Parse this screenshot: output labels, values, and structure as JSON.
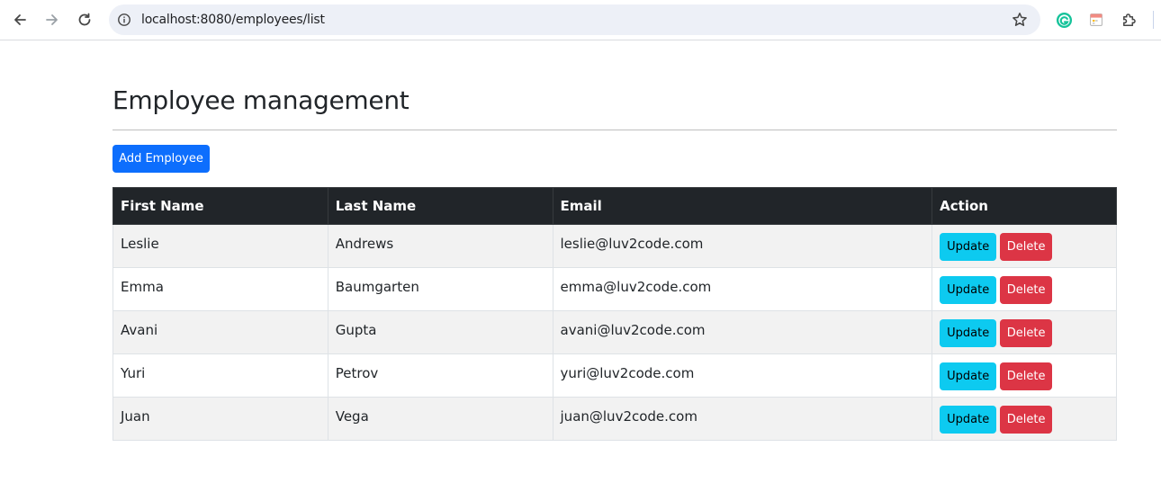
{
  "browser": {
    "url": "localhost:8080/employees/list"
  },
  "page": {
    "title": "Employee management",
    "add_button_label": "Add Employee"
  },
  "table": {
    "headers": {
      "first_name": "First Name",
      "last_name": "Last Name",
      "email": "Email",
      "action": "Action"
    },
    "rows": [
      {
        "first_name": "Leslie",
        "last_name": "Andrews",
        "email": "leslie@luv2code.com",
        "update_label": "Update",
        "delete_label": "Delete"
      },
      {
        "first_name": "Emma",
        "last_name": "Baumgarten",
        "email": "emma@luv2code.com",
        "update_label": "Update",
        "delete_label": "Delete"
      },
      {
        "first_name": "Avani",
        "last_name": "Gupta",
        "email": "avani@luv2code.com",
        "update_label": "Update",
        "delete_label": "Delete"
      },
      {
        "first_name": "Yuri",
        "last_name": "Petrov",
        "email": "yuri@luv2code.com",
        "update_label": "Update",
        "delete_label": "Delete"
      },
      {
        "first_name": "Juan",
        "last_name": "Vega",
        "email": "juan@luv2code.com",
        "update_label": "Update",
        "delete_label": "Delete"
      }
    ]
  },
  "colors": {
    "primary": "#0d6efd",
    "info": "#0dcaf0",
    "danger": "#dc3545",
    "table_header": "#212529",
    "stripe": "#f2f2f2"
  },
  "icons": {
    "back": "arrow-left-icon",
    "forward": "arrow-right-icon",
    "reload": "reload-icon",
    "site_info": "info-icon",
    "bookmark": "star-icon",
    "grammarly": "grammarly-icon",
    "extension_calendar": "calendar-icon",
    "extensions": "puzzle-icon"
  }
}
